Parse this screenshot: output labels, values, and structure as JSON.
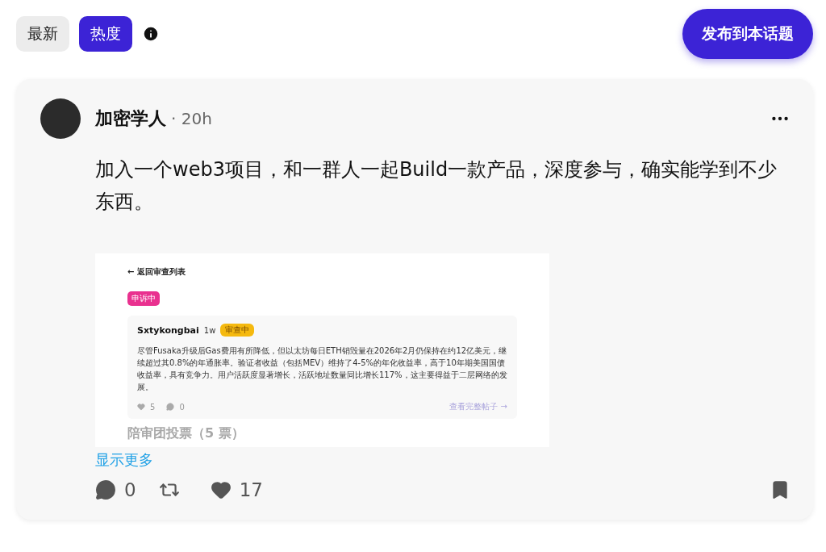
{
  "sort_tabs": [
    {
      "label": "最新",
      "selected": false
    },
    {
      "label": "热度",
      "selected": true
    }
  ],
  "publish_button": "发布到本话题",
  "post": {
    "author": "加密学人",
    "time": "· 20h",
    "text": "加入一个web3项目，和一群人一起Build一款产品，深度参与，确实能学到不少东西。",
    "screenshot": {
      "back_link": "← 返回审查列表",
      "status_tag": "申诉中",
      "inner_post": {
        "author": "Sxtykongbai",
        "time": "1w",
        "tag": "审查中",
        "text": "尽管Fusaka升级后Gas费用有所降低，但以太坊每日ETH销毁量在2026年2月仍保持在约12亿美元，继续超过其0.8%的年通胀率。验证者收益（包括MEV）维持了4-5%的年化收益率，高于10年期美国国债收益率，具有竞争力。用户活跃度显著增长，活跃地址数量同比增长117%，这主要得益于二层网络的发展。",
        "likes": "5",
        "comments": "0",
        "view_link": "查看完整帖子 →"
      },
      "section_title": "陪审团投票（5 票）"
    },
    "show_more": "显示更多",
    "comments": "0",
    "likes": "17",
    "bookmarked": true
  }
}
